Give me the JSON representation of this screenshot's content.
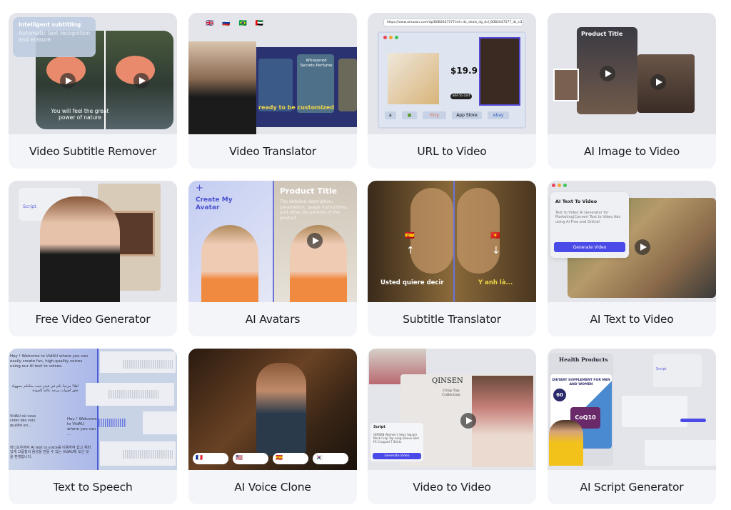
{
  "cards": [
    {
      "title": "Video Subtitle Remover",
      "overlay_title": "Intelligent subtitling",
      "overlay_sub": "Automatic text recognition and erasure",
      "caption": "You will feel the great power of nature"
    },
    {
      "title": "Video Translator",
      "poster": "Whispered Secrets Perfume",
      "caption": "ready to be customized"
    },
    {
      "title": "URL to Video",
      "url": "https://www.amazon.com/dp/B0B2647577/ref=dx_deals_dg_dcl_B0B2647577_dt_sl14_8b",
      "price": "$19.9",
      "cart": "add to cart",
      "stores": [
        "a",
        "Etsy",
        "App Store",
        "ebay"
      ]
    },
    {
      "title": "AI Image to Video",
      "overlay_title": "Product Title"
    },
    {
      "title": "Free Video Generator",
      "script": "Script"
    },
    {
      "title": "AI Avatars",
      "create": "Create My Avatar",
      "product_title": "Product Title",
      "product_desc": "The detailed description, parameters, usage instructions, and other documents of the product."
    },
    {
      "title": "Subtitle Translator",
      "caption_left": "Usted quiere decir",
      "caption_right": "Y anh là..."
    },
    {
      "title": "AI Text to Video",
      "panel_title": "AI Text To Video",
      "panel_desc": "Text to Video AI Generator for Marketing|Convert Text to Video Ads using AI Free and Online!",
      "button": "Generate Video"
    },
    {
      "title": "Text to Speech",
      "lines": [
        "Hey ! Welcome to VidAU where you can easily create fun, high-quality voices using our AI text to voices.",
        "اهلا! مرحبا بكم في فيدو حيث يمكنكم بسهولة خلق أصوات مرحة عالية الجودة",
        "VidAU où vous créer des voix qualité en...",
        "Hey ! Welcome to VidAU where you can ...",
        "비디오우에서 AI text to voice를 이용하여 쉽고 재미있게 고품질의 음성을 만들 수 있는 VidAU에 오신 것을 환영합니다."
      ]
    },
    {
      "title": "AI Voice Clone",
      "flags": [
        "🇫🇷",
        "🇺🇸",
        "🇪🇸",
        "🇰🇷"
      ]
    },
    {
      "title": "Video to Video",
      "brand": "QINSEN",
      "collection": "Crop Top Collection",
      "script_label": "Script",
      "script_text": "QINSEN Women's Sexy Square Neck Crop Top Long Sleeve Slim Fit Cropped T Shirts",
      "button": "Generate Video"
    },
    {
      "title": "AI Script Generator",
      "heading": "Health Products",
      "banner": "DIETARY SUPPLEMENT FOR MEN AND WOMEN",
      "badge": "60",
      "product": "CoQ10",
      "script_label": "Script"
    }
  ],
  "colors": {
    "card_bg": "#f4f5f8",
    "thumb_bg": "#e3e5ea",
    "accent": "#4a4ae8",
    "text": "#1b1b1f"
  }
}
